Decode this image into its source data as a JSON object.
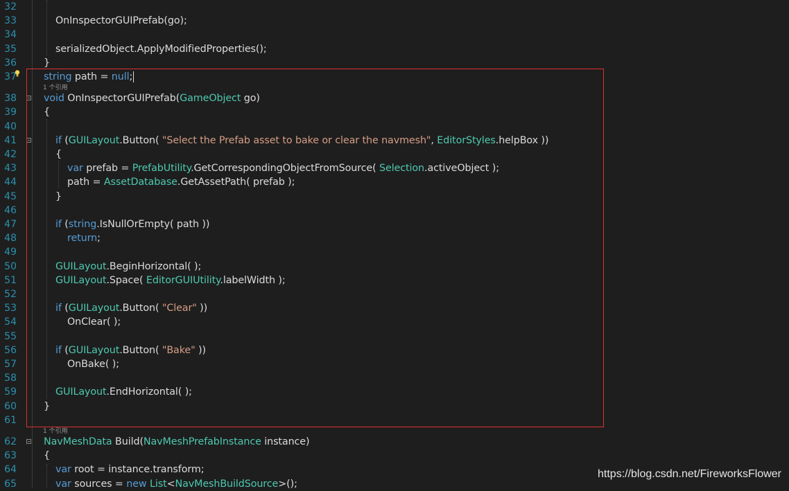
{
  "editor": {
    "lines": [
      {
        "n": "32",
        "segs": []
      },
      {
        "n": "33",
        "indent": 2,
        "segs": [
          {
            "c": "tx",
            "t": "OnInspectorGUIPrefab(go);"
          }
        ]
      },
      {
        "n": "34",
        "segs": []
      },
      {
        "n": "35",
        "indent": 2,
        "segs": [
          {
            "c": "tx",
            "t": "serializedObject.ApplyModifiedProperties();"
          }
        ]
      },
      {
        "n": "36",
        "indent": 1,
        "segs": [
          {
            "c": "tx",
            "t": "}"
          }
        ]
      },
      {
        "n": "37",
        "indent": 1,
        "segs": [
          {
            "c": "kw",
            "t": "string"
          },
          {
            "c": "tx",
            "t": " path = "
          },
          {
            "c": "kw",
            "t": "null"
          },
          {
            "c": "tx",
            "t": ";"
          }
        ]
      },
      {
        "n": "38",
        "indent": 1,
        "lens": "1 个引用",
        "segs": [
          {
            "c": "kw",
            "t": "void"
          },
          {
            "c": "tx",
            "t": " OnInspectorGUIPrefab("
          },
          {
            "c": "ty",
            "t": "GameObject"
          },
          {
            "c": "tx",
            "t": " go)"
          }
        ]
      },
      {
        "n": "39",
        "indent": 1,
        "segs": [
          {
            "c": "tx",
            "t": "{"
          }
        ]
      },
      {
        "n": "40",
        "segs": []
      },
      {
        "n": "41",
        "indent": 2,
        "segs": [
          {
            "c": "kw",
            "t": "if"
          },
          {
            "c": "tx",
            "t": " ("
          },
          {
            "c": "ty",
            "t": "GUILayout"
          },
          {
            "c": "tx",
            "t": ".Button( "
          },
          {
            "c": "st",
            "t": "\"Select the Prefab asset to bake or clear the navmesh\""
          },
          {
            "c": "tx",
            "t": ", "
          },
          {
            "c": "ty",
            "t": "EditorStyles"
          },
          {
            "c": "tx",
            "t": ".helpBox ))"
          }
        ]
      },
      {
        "n": "42",
        "indent": 2,
        "segs": [
          {
            "c": "tx",
            "t": "{"
          }
        ]
      },
      {
        "n": "43",
        "indent": 3,
        "segs": [
          {
            "c": "kw",
            "t": "var"
          },
          {
            "c": "tx",
            "t": " prefab = "
          },
          {
            "c": "ty",
            "t": "PrefabUtility"
          },
          {
            "c": "tx",
            "t": ".GetCorrespondingObjectFromSource( "
          },
          {
            "c": "ty",
            "t": "Selection"
          },
          {
            "c": "tx",
            "t": ".activeObject );"
          }
        ]
      },
      {
        "n": "44",
        "indent": 3,
        "segs": [
          {
            "c": "tx",
            "t": "path = "
          },
          {
            "c": "ty",
            "t": "AssetDatabase"
          },
          {
            "c": "tx",
            "t": ".GetAssetPath( prefab );"
          }
        ]
      },
      {
        "n": "45",
        "indent": 2,
        "segs": [
          {
            "c": "tx",
            "t": "}"
          }
        ]
      },
      {
        "n": "46",
        "segs": []
      },
      {
        "n": "47",
        "indent": 2,
        "segs": [
          {
            "c": "kw",
            "t": "if"
          },
          {
            "c": "tx",
            "t": " ("
          },
          {
            "c": "kw",
            "t": "string"
          },
          {
            "c": "tx",
            "t": ".IsNullOrEmpty( path ))"
          }
        ]
      },
      {
        "n": "48",
        "indent": 3,
        "segs": [
          {
            "c": "kw",
            "t": "return"
          },
          {
            "c": "tx",
            "t": ";"
          }
        ]
      },
      {
        "n": "49",
        "segs": []
      },
      {
        "n": "50",
        "indent": 2,
        "segs": [
          {
            "c": "ty",
            "t": "GUILayout"
          },
          {
            "c": "tx",
            "t": ".BeginHorizontal( );"
          }
        ]
      },
      {
        "n": "51",
        "indent": 2,
        "segs": [
          {
            "c": "ty",
            "t": "GUILayout"
          },
          {
            "c": "tx",
            "t": ".Space( "
          },
          {
            "c": "ty",
            "t": "EditorGUIUtility"
          },
          {
            "c": "tx",
            "t": ".labelWidth );"
          }
        ]
      },
      {
        "n": "52",
        "segs": []
      },
      {
        "n": "53",
        "indent": 2,
        "segs": [
          {
            "c": "kw",
            "t": "if"
          },
          {
            "c": "tx",
            "t": " ("
          },
          {
            "c": "ty",
            "t": "GUILayout"
          },
          {
            "c": "tx",
            "t": ".Button( "
          },
          {
            "c": "st",
            "t": "\"Clear\""
          },
          {
            "c": "tx",
            "t": " ))"
          }
        ]
      },
      {
        "n": "54",
        "indent": 3,
        "segs": [
          {
            "c": "tx",
            "t": "OnClear( );"
          }
        ]
      },
      {
        "n": "55",
        "segs": []
      },
      {
        "n": "56",
        "indent": 2,
        "segs": [
          {
            "c": "kw",
            "t": "if"
          },
          {
            "c": "tx",
            "t": " ("
          },
          {
            "c": "ty",
            "t": "GUILayout"
          },
          {
            "c": "tx",
            "t": ".Button( "
          },
          {
            "c": "st",
            "t": "\"Bake\""
          },
          {
            "c": "tx",
            "t": " ))"
          }
        ]
      },
      {
        "n": "57",
        "indent": 3,
        "segs": [
          {
            "c": "tx",
            "t": "OnBake( );"
          }
        ]
      },
      {
        "n": "58",
        "segs": []
      },
      {
        "n": "59",
        "indent": 2,
        "segs": [
          {
            "c": "ty",
            "t": "GUILayout"
          },
          {
            "c": "tx",
            "t": ".EndHorizontal( );"
          }
        ]
      },
      {
        "n": "60",
        "indent": 1,
        "segs": [
          {
            "c": "tx",
            "t": "}"
          }
        ]
      },
      {
        "n": "61",
        "segs": []
      },
      {
        "n": "62",
        "indent": 1,
        "lens": "1 个引用",
        "segs": [
          {
            "c": "ty",
            "t": "NavMeshData"
          },
          {
            "c": "tx",
            "t": " Build("
          },
          {
            "c": "ty",
            "t": "NavMeshPrefabInstance"
          },
          {
            "c": "tx",
            "t": " instance)"
          }
        ]
      },
      {
        "n": "63",
        "indent": 1,
        "segs": [
          {
            "c": "tx",
            "t": "{"
          }
        ]
      },
      {
        "n": "64",
        "indent": 2,
        "segs": [
          {
            "c": "kw",
            "t": "var"
          },
          {
            "c": "tx",
            "t": " root = instance.transform;"
          }
        ]
      },
      {
        "n": "65",
        "indent": 2,
        "segs": [
          {
            "c": "kw",
            "t": "var"
          },
          {
            "c": "tx",
            "t": " sources = "
          },
          {
            "c": "kw",
            "t": "new"
          },
          {
            "c": "tx",
            "t": " "
          },
          {
            "c": "ty",
            "t": "List"
          },
          {
            "c": "tx",
            "t": "<"
          },
          {
            "c": "ty",
            "t": "NavMeshBuildSource"
          },
          {
            "c": "tx",
            "t": ">();"
          }
        ]
      }
    ]
  },
  "watermark": "https://blog.csdn.net/FireworksFlower",
  "colors": {
    "background": "#1e1e1e",
    "line_number": "#2b91af",
    "keyword": "#569cd6",
    "type": "#4ec9b0",
    "string": "#d69d85",
    "text": "#dcdcdc",
    "highlight_box": "#e03131"
  },
  "icons": {
    "lightbulb": "lightbulb-icon",
    "fold": "collapse-icon"
  }
}
